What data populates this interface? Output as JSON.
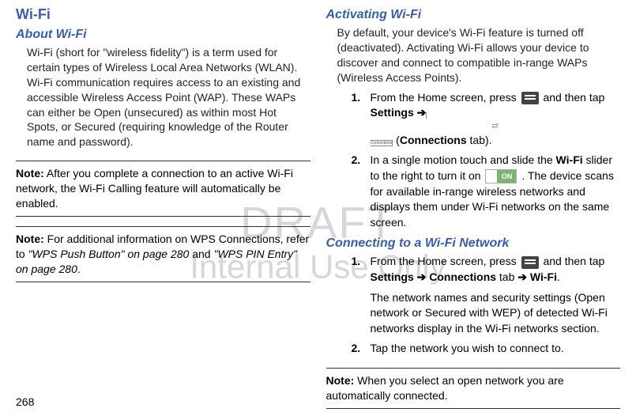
{
  "watermark": {
    "line1": "DRAFT",
    "line2": "Internal Use Only"
  },
  "pageNumber": "268",
  "left": {
    "h1": "Wi-Fi",
    "h2": "About Wi-Fi",
    "para1": "Wi-Fi (short for \"wireless fidelity\") is a term used for certain types of Wireless Local Area Networks (WLAN). Wi-Fi communication requires access to an existing and accessible Wireless Access Point (WAP). These WAPs can either be Open (unsecured) as within most Hot Spots, or Secured (requiring knowledge of the Router name and password).",
    "note1Label": "Note:",
    "note1": "After you complete a connection to an active Wi-Fi network, the Wi-Fi Calling feature will automatically be enabled.",
    "note2Label": "Note:",
    "note2a": "For additional information on WPS Connections, refer to ",
    "note2b": "\"WPS Push Button\" on page 280",
    "note2c": " and ",
    "note2d": "\"WPS PIN Entry\" on page 280",
    "note2e": "."
  },
  "right": {
    "h2a": "Activating Wi-Fi",
    "para2": "By default, your device's Wi-Fi feature is turned off (deactivated). Activating Wi-Fi allows your device to discover and connect to compatible in-range WAPs (Wireless Access Points).",
    "step1num": "1.",
    "step1a": "From the Home screen, press ",
    "step1b": " and then tap ",
    "step1c": "Settings",
    "step1d": " ➔ ",
    "step1e": " (",
    "step1f": "Connections",
    "step1g": " tab).",
    "connIconTop": "⇄",
    "connIconBot": "Connections",
    "step2num": "2.",
    "step2a": "In a single motion touch and slide the ",
    "step2b": "Wi-Fi",
    "step2c": " slider to the right to turn it on ",
    "step2on": "ON",
    "step2d": " . The device scans for available in-range wireless networks and displays them under Wi-Fi networks on the same screen.",
    "h2b": "Connecting to a Wi-Fi Network",
    "cstep1num": "1.",
    "cstep1a": "From the Home screen, press ",
    "cstep1b": " and then tap ",
    "cstep1c": "Settings",
    "cstep1d": " ➔ ",
    "cstep1e": "Connections",
    "cstep1f": " tab ",
    "cstep1g": "➔ ",
    "cstep1h": "Wi-Fi",
    "cstep1i": ".",
    "csub": "The network names and security settings (Open network or Secured with WEP) of detected Wi-Fi networks display in the Wi-Fi networks section.",
    "cstep2num": "2.",
    "cstep2": "Tap the network you wish to connect to.",
    "note3Label": "Note:",
    "note3": "When you select an open network you are automatically connected."
  }
}
